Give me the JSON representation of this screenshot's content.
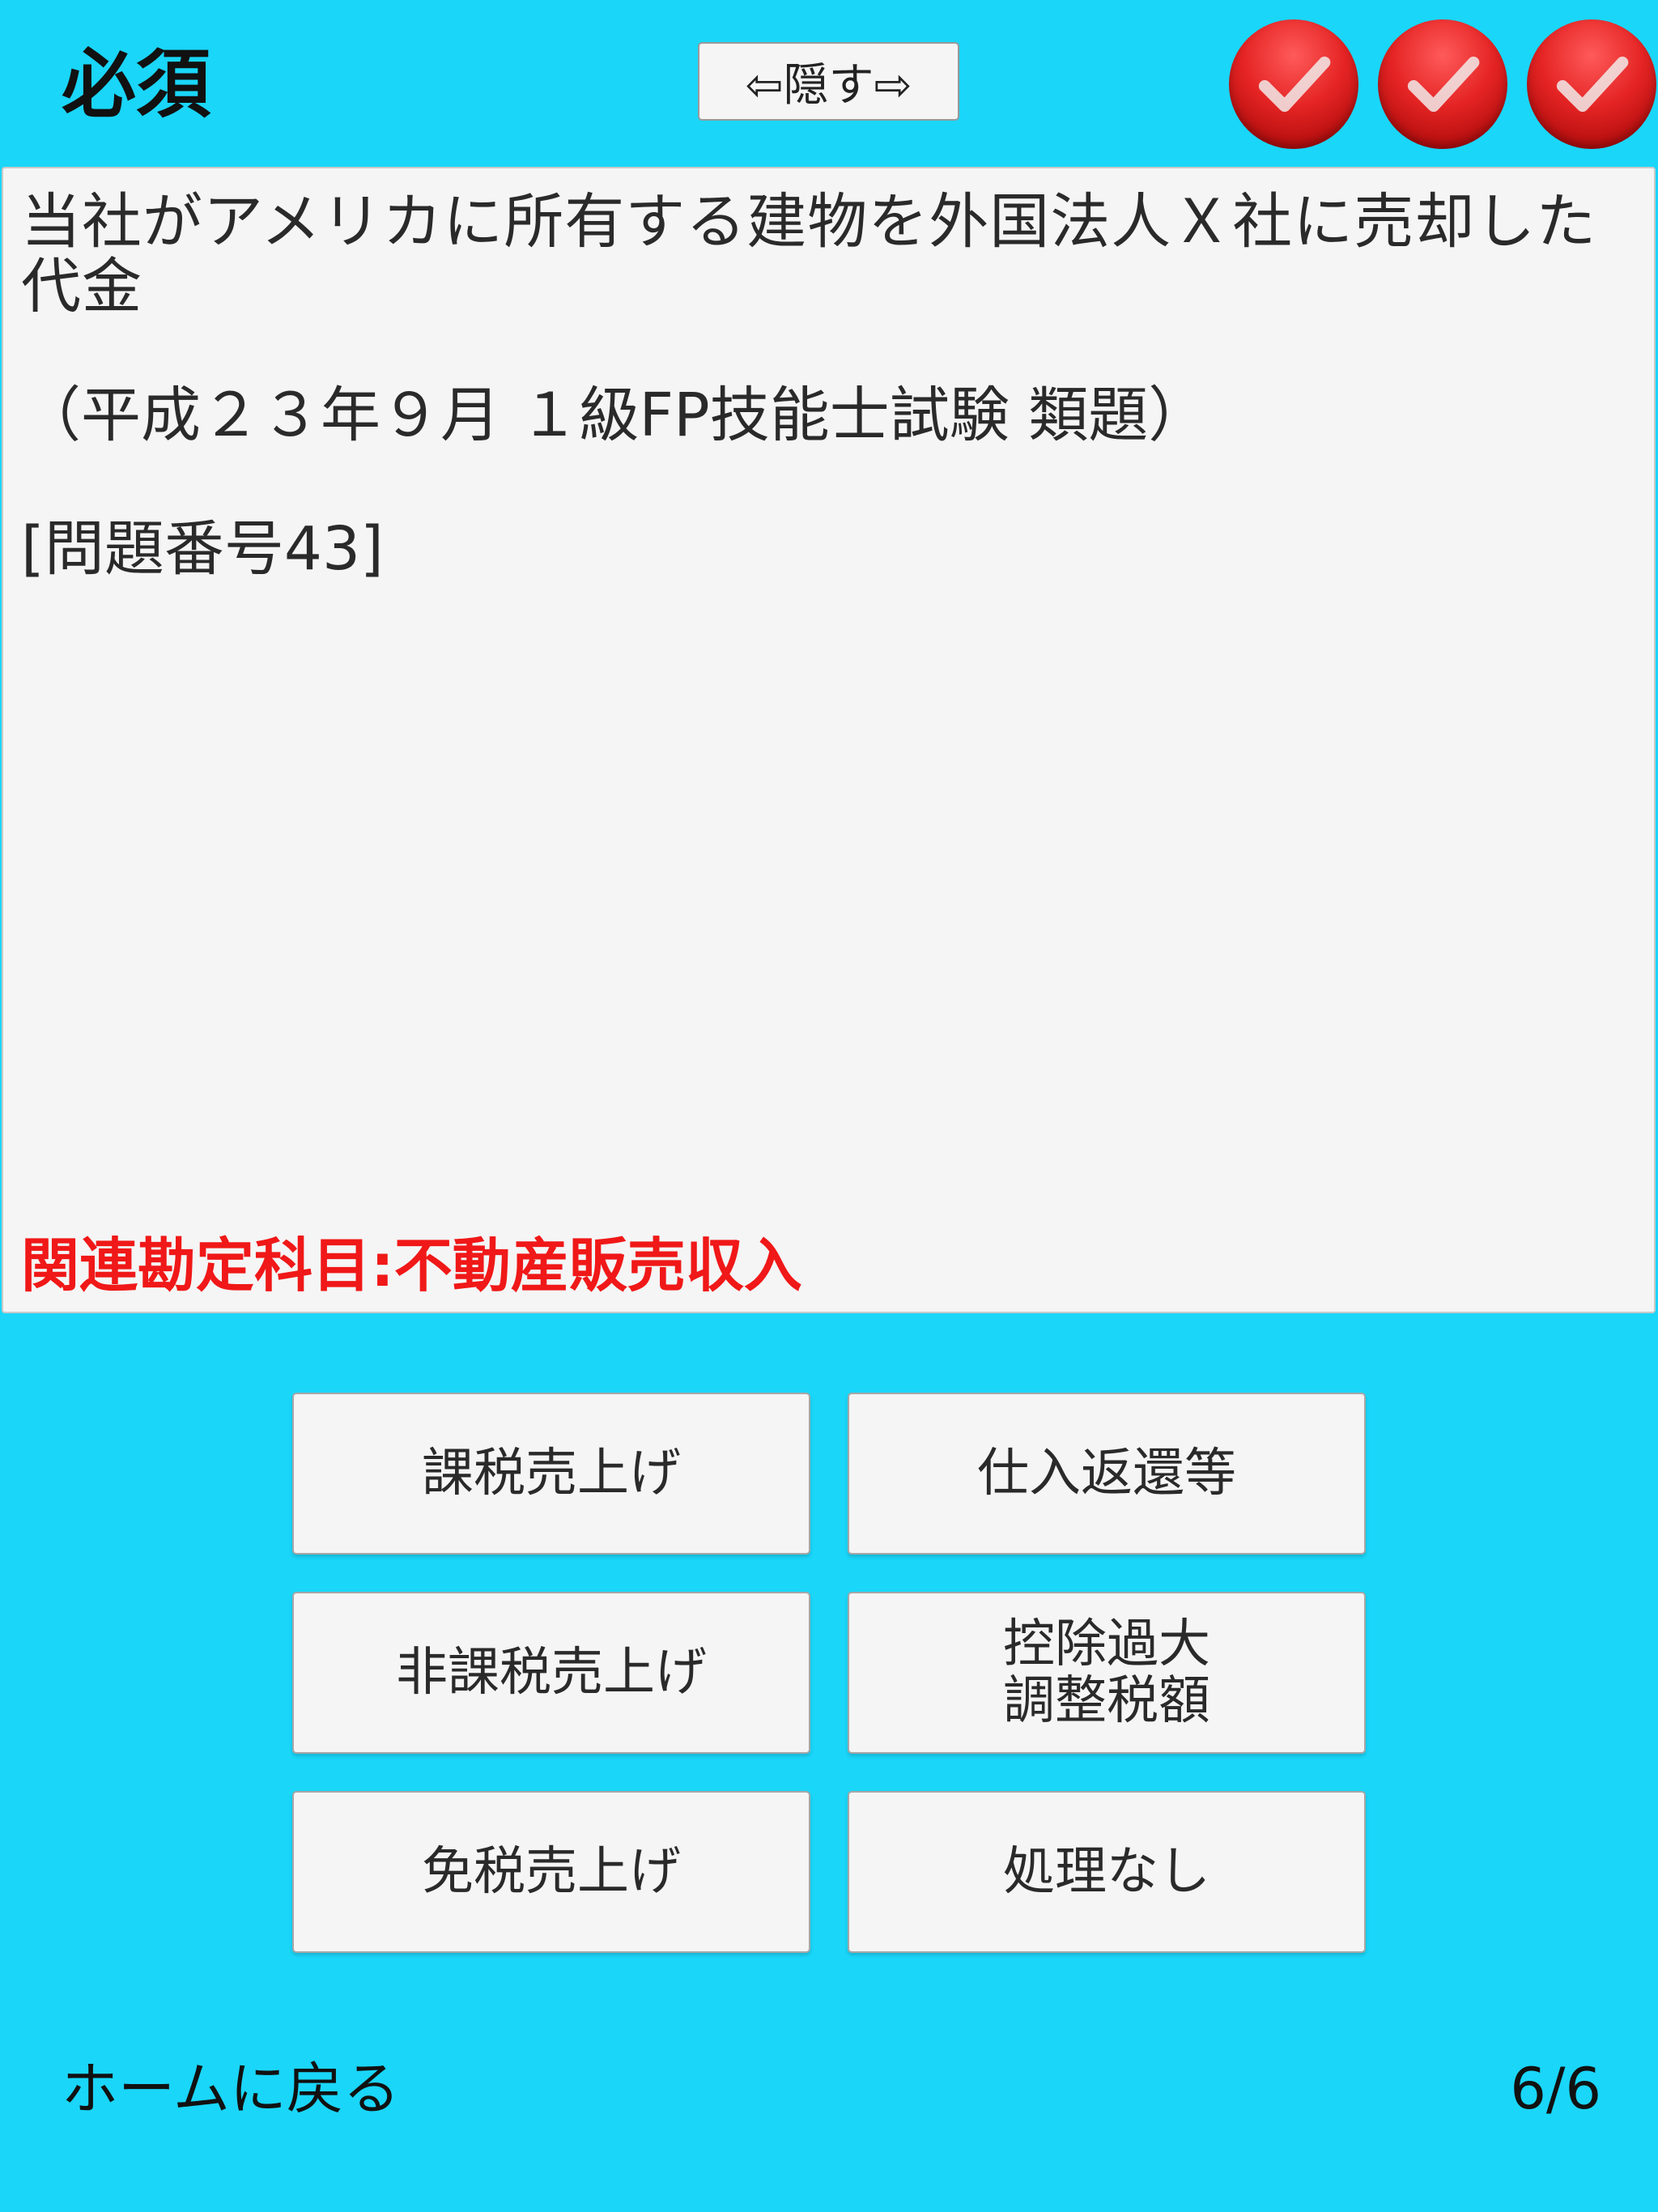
{
  "header": {
    "category_label": "必須",
    "hide_button_label": "⇦隠す⇨",
    "badges": [
      "check-icon",
      "check-icon",
      "check-icon"
    ]
  },
  "question": {
    "text": "当社がアメリカに所有する建物を外国法人Ｘ社に売却した代金",
    "source": "（平成２３年９月 １級FP技能士試験 類題）",
    "problem_number": "[問題番号43]",
    "related_account": "関連勘定科目:不動産販売収入"
  },
  "answers": [
    {
      "label": "課税売上げ"
    },
    {
      "label": "仕入返還等"
    },
    {
      "label": "非課税売上げ"
    },
    {
      "label": "控除過大\n調整税額"
    },
    {
      "label": "免税売上げ"
    },
    {
      "label": "処理なし"
    }
  ],
  "footer": {
    "home_label": "ホームに戻る",
    "page_counter": "6/6"
  },
  "colors": {
    "background": "#1ad6f9",
    "panel": "#f5f5f5",
    "related_text": "#f01818",
    "badge": "#e52424"
  }
}
